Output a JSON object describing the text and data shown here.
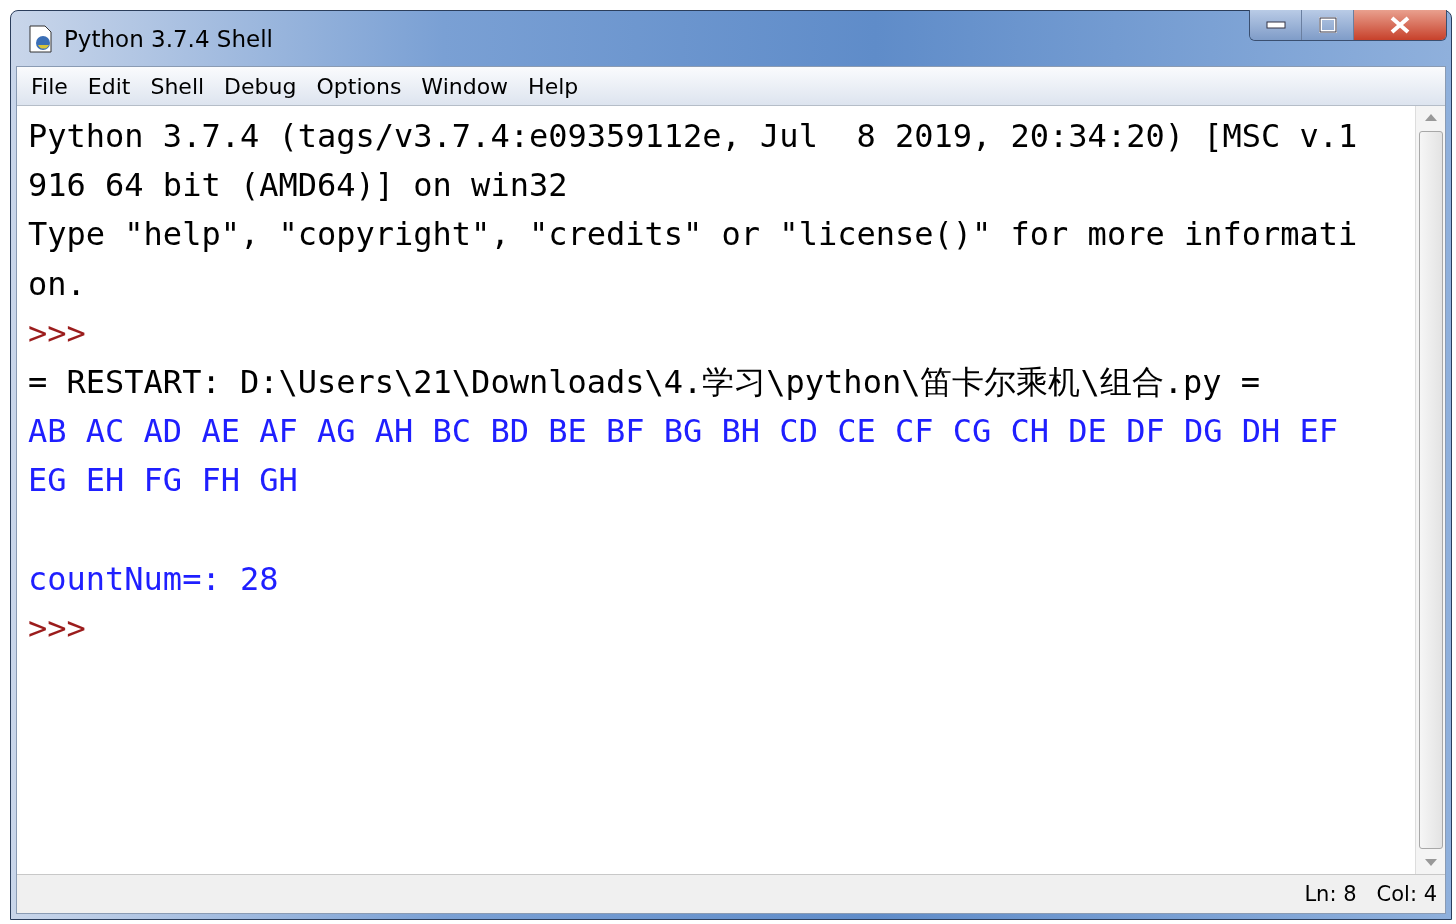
{
  "window": {
    "title": "Python 3.7.4 Shell"
  },
  "menu": [
    "File",
    "Edit",
    "Shell",
    "Debug",
    "Options",
    "Window",
    "Help"
  ],
  "shell_lines": [
    {
      "kind": "output",
      "text": "Python 3.7.4 (tags/v3.7.4:e09359112e, Jul  8 2019, 20:34:20) [MSC v.1"
    },
    {
      "kind": "output",
      "text": "916 64 bit (AMD64)] on win32"
    },
    {
      "kind": "output",
      "text": "Type \"help\", \"copyright\", \"credits\" or \"license()\" for more informati"
    },
    {
      "kind": "output",
      "text": "on."
    },
    {
      "kind": "prompt",
      "text": ">>>"
    },
    {
      "kind": "output",
      "text": "= RESTART: D:\\Users\\21\\Downloads\\4.学习\\python\\笛卡尔乘机\\组合.py ="
    },
    {
      "kind": "stdout",
      "text": "AB AC AD AE AF AG AH BC BD BE BF BG BH CD CE CF CG CH DE DF DG DH EF"
    },
    {
      "kind": "stdout",
      "text": "EG EH FG FH GH"
    },
    {
      "kind": "blank"
    },
    {
      "kind": "stdout",
      "text": "countNum=: 28"
    },
    {
      "kind": "prompt",
      "text": ">>>"
    }
  ],
  "status_bar": {
    "line": "Ln: 8",
    "column": "Col: 4"
  }
}
